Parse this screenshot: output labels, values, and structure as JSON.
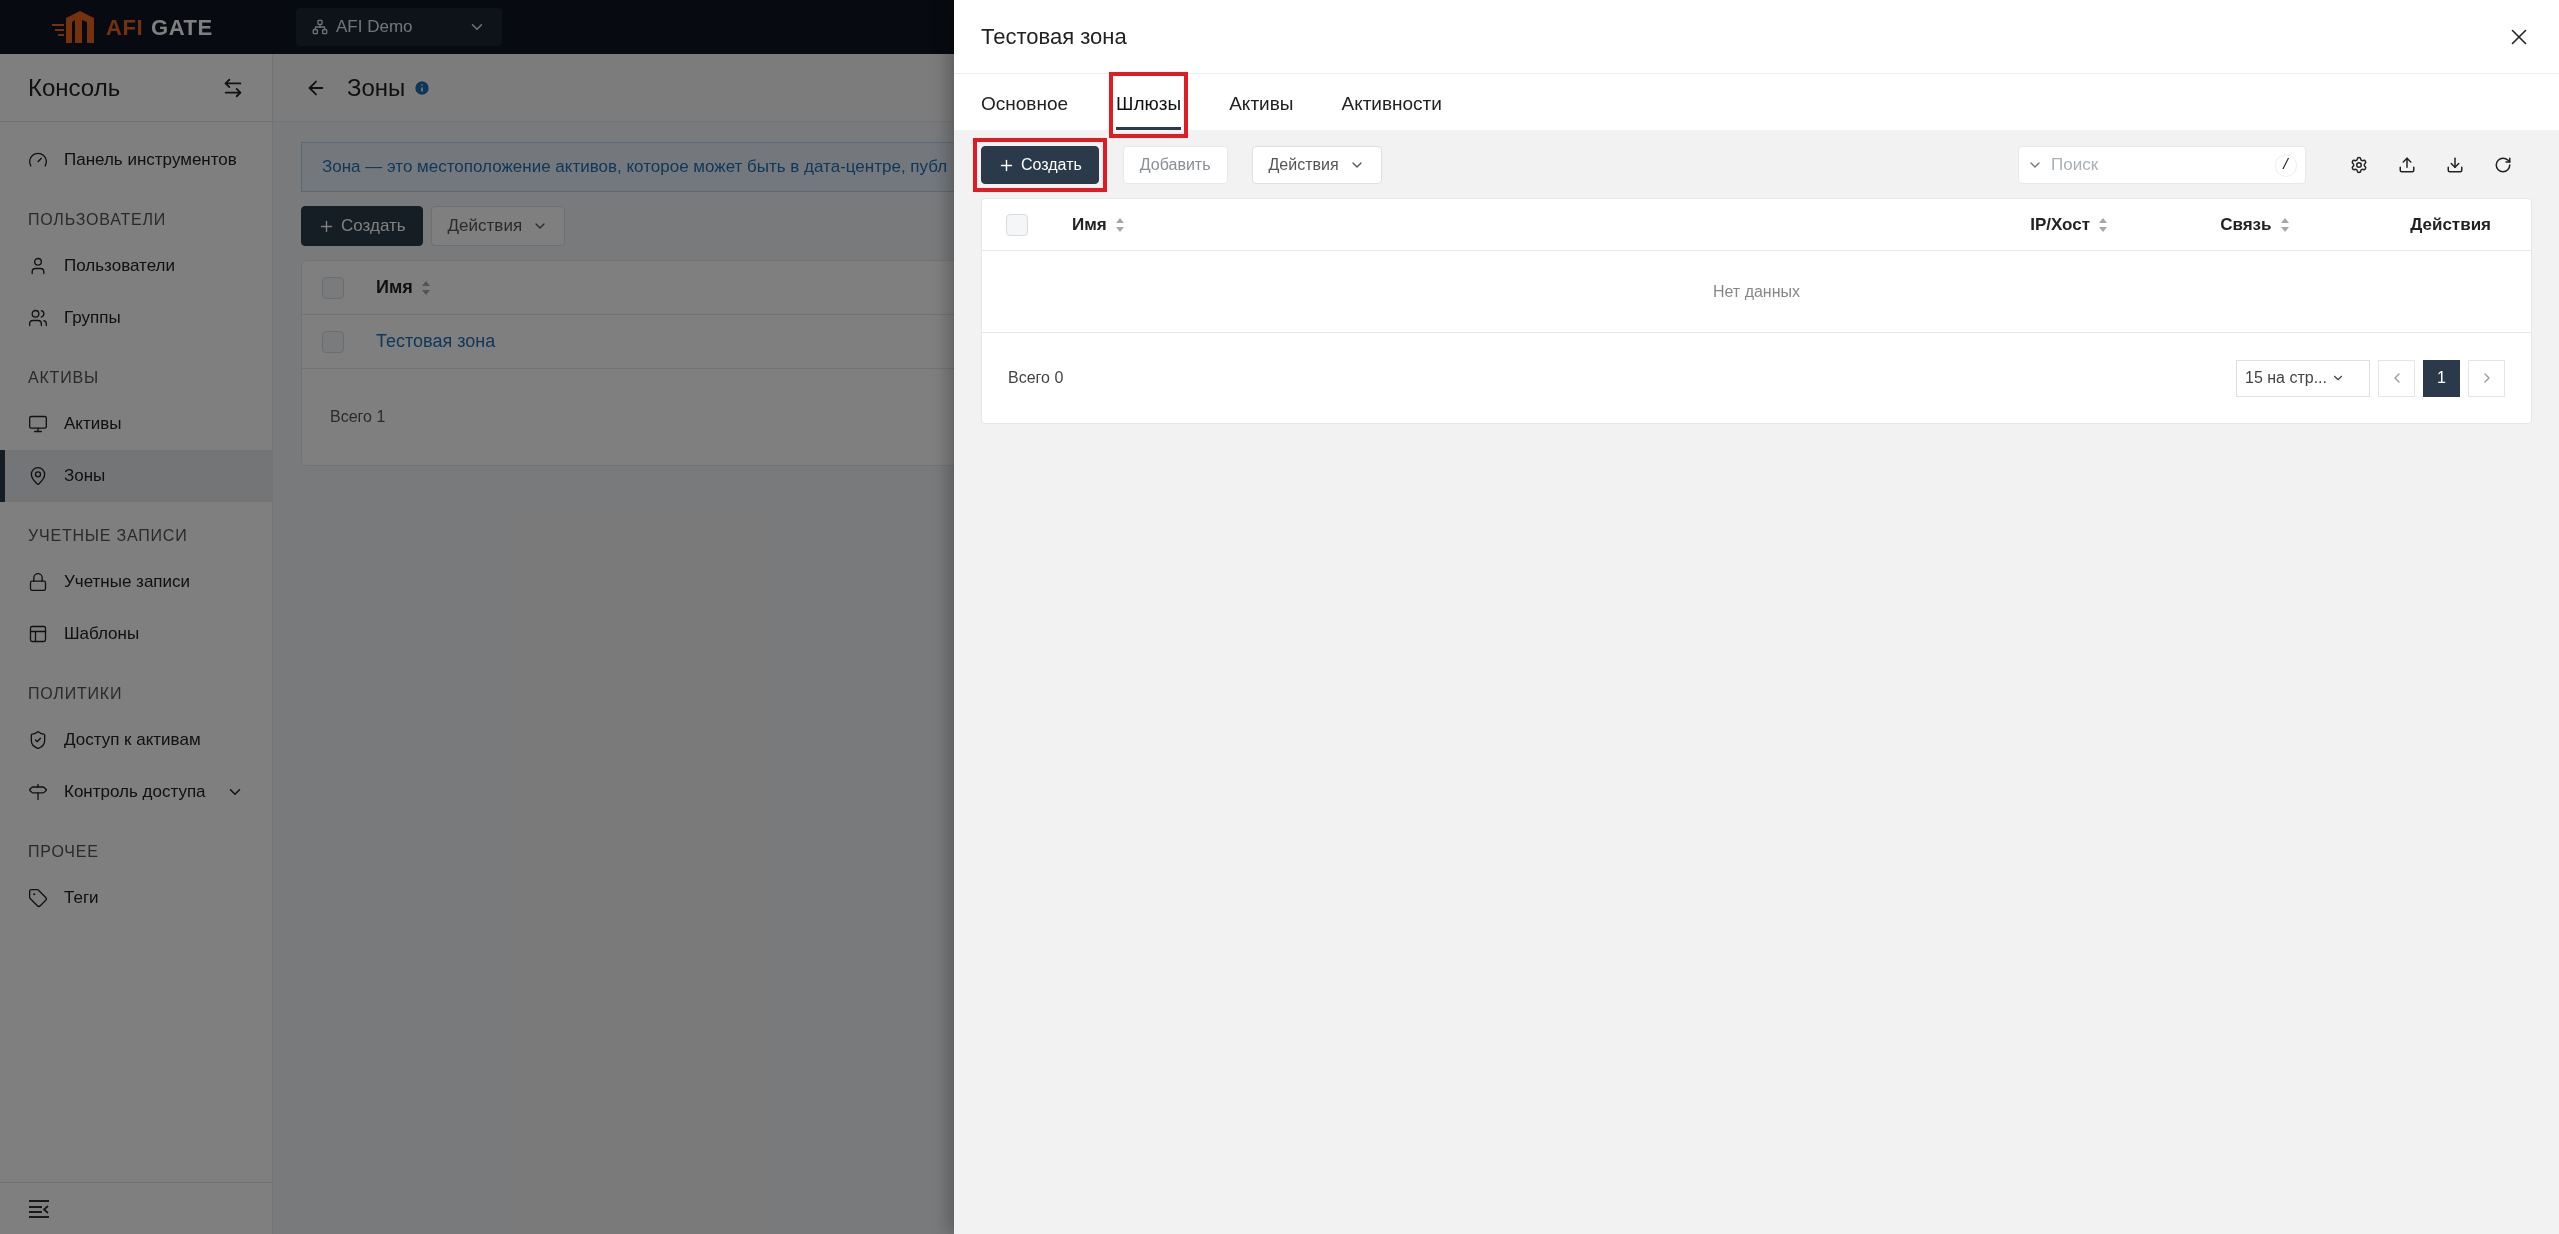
{
  "header": {
    "brand": "AFI",
    "product": "GATE",
    "org_selector": "AFI Demo"
  },
  "sidebar": {
    "title": "Консоль",
    "sections": [
      {
        "items": [
          {
            "label": "Панель инструментов",
            "selected": false
          }
        ]
      },
      {
        "heading": "ПОЛЬЗОВАТЕЛИ",
        "items": [
          {
            "label": "Пользователи",
            "selected": false
          },
          {
            "label": "Группы",
            "selected": false
          }
        ]
      },
      {
        "heading": "АКТИВЫ",
        "items": [
          {
            "label": "Активы",
            "selected": false
          },
          {
            "label": "Зоны",
            "selected": true
          }
        ]
      },
      {
        "heading": "УЧЕТНЫЕ ЗАПИСИ",
        "items": [
          {
            "label": "Учетные записи",
            "selected": false
          },
          {
            "label": "Шаблоны",
            "selected": false
          }
        ]
      },
      {
        "heading": "ПОЛИТИКИ",
        "items": [
          {
            "label": "Доступ к активам",
            "selected": false
          },
          {
            "label": "Контроль доступа",
            "selected": false,
            "expanded": false
          }
        ]
      },
      {
        "heading": "ПРОЧЕЕ",
        "items": [
          {
            "label": "Теги",
            "selected": false
          }
        ]
      }
    ]
  },
  "page": {
    "title": "Зоны",
    "banner": "Зона — это местоположение активов, которое может быть в дата-центре, публ",
    "buttons": [
      {
        "label": "Создать",
        "kind": "primary"
      },
      {
        "label": "Действия",
        "kind": "dropdown"
      }
    ],
    "table": {
      "select_all_checked": false,
      "columns": [
        {
          "label": "Имя",
          "sortable": true
        }
      ],
      "rows": [
        {
          "name": "Тестовая зона",
          "checked": false
        }
      ],
      "total": "Всего 1"
    }
  },
  "drawer": {
    "title": "Тестовая зона",
    "tabs": [
      {
        "label": "Основное",
        "selected": false,
        "highlighted": false
      },
      {
        "label": "Шлюзы",
        "selected": true,
        "highlighted": true
      },
      {
        "label": "Активы",
        "selected": false,
        "highlighted": false
      },
      {
        "label": "Активности",
        "selected": false,
        "highlighted": false
      }
    ],
    "buttons": [
      {
        "label": "Создать",
        "kind": "primary",
        "highlighted": true
      },
      {
        "label": "Добавить",
        "kind": "plain",
        "highlighted": false
      },
      {
        "label": "Действия",
        "kind": "dropdown",
        "highlighted": false
      }
    ],
    "search": {
      "placeholder": "Поиск",
      "shortcut": "/"
    },
    "table": {
      "select_all_checked": false,
      "columns": [
        {
          "label": "Имя",
          "sortable": true
        },
        {
          "label": "IP/Хост",
          "sortable": true
        },
        {
          "label": "Связь",
          "sortable": true
        },
        {
          "label": "Действия",
          "sortable": false
        }
      ],
      "empty": "Нет данных",
      "total": "Всего 0",
      "page_size": "15 на стр...",
      "pages": [
        {
          "label": "1",
          "selected": true
        }
      ]
    }
  }
}
